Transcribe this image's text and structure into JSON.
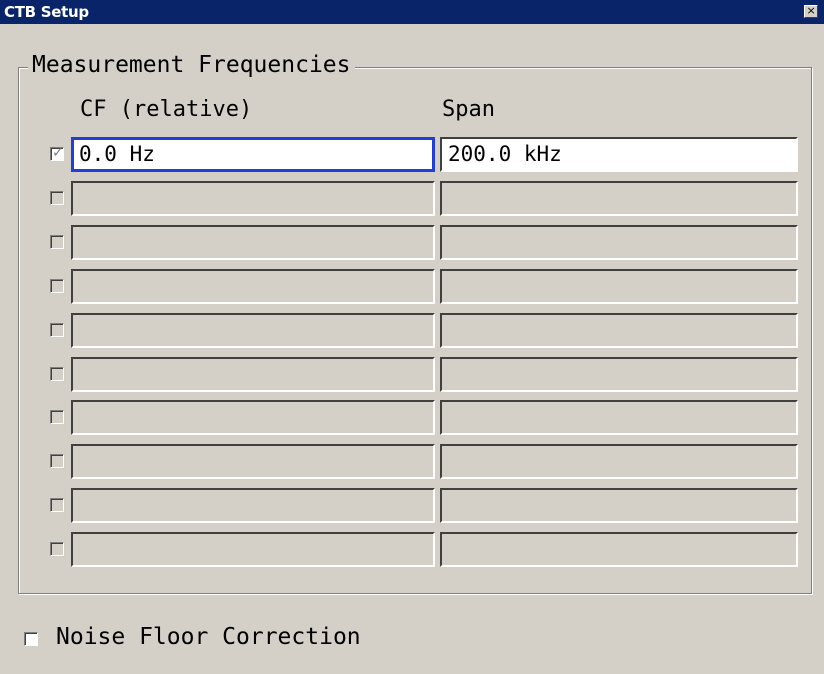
{
  "window": {
    "title": "CTB Setup",
    "close_label": "×"
  },
  "group": {
    "title": "Measurement Frequencies",
    "col_cf": "CF (relative)",
    "col_span": "Span"
  },
  "rows": [
    {
      "checked": true,
      "cf": "0.0 Hz",
      "span": "200.0 kHz"
    },
    {
      "checked": false,
      "cf": "",
      "span": ""
    },
    {
      "checked": false,
      "cf": "",
      "span": ""
    },
    {
      "checked": false,
      "cf": "",
      "span": ""
    },
    {
      "checked": false,
      "cf": "",
      "span": ""
    },
    {
      "checked": false,
      "cf": "",
      "span": ""
    },
    {
      "checked": false,
      "cf": "",
      "span": ""
    },
    {
      "checked": false,
      "cf": "",
      "span": ""
    },
    {
      "checked": false,
      "cf": "",
      "span": ""
    },
    {
      "checked": false,
      "cf": "",
      "span": ""
    }
  ],
  "noise_floor": {
    "label": "Noise Floor Correction",
    "checked": false
  },
  "colors": {
    "titlebar": "#0a246a",
    "focus_border": "#1f3fd6",
    "dialog_bg": "#d4d0c8"
  }
}
